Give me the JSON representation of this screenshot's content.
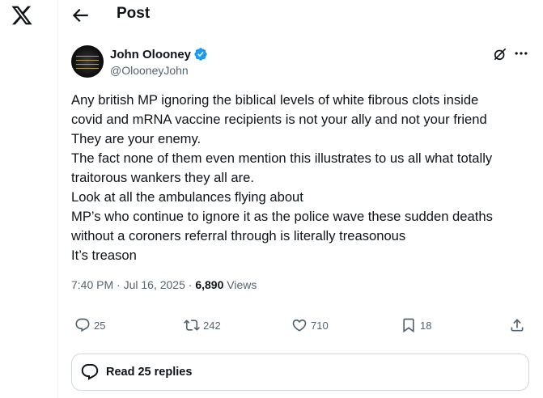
{
  "header": {
    "title": "Post"
  },
  "author": {
    "display_name": "John Olooney",
    "handle": "@OlooneyJohn",
    "verified_color": "#1d9bf0"
  },
  "tweet": {
    "lines": [
      "Any british MP ignoring the biblical levels of white fibrous clots inside",
      "covid and mRNA vaccine recipients is not your ally and not your friend",
      "They are your enemy.",
      "The fact none of them even mention this illustrates to us all what totally",
      "traitorous wankers they all are.",
      "Look at all the ambulances flying about",
      "MP’s who continue to ignore it as the police wave these sudden deaths",
      "without a coroners referral through is literally treasonous",
      "It’s treason"
    ]
  },
  "meta": {
    "time": "7:40 PM",
    "separator": "·",
    "date": "Jul 16, 2025",
    "views_count": "6,890",
    "views_label": "Views"
  },
  "actions": {
    "replies": "25",
    "reposts": "242",
    "likes": "710",
    "bookmarks": "18"
  },
  "icons": [
    "x-logo-icon",
    "back-arrow-icon",
    "verified-badge-icon",
    "grok-icon",
    "more-icon",
    "reply-icon",
    "repost-icon",
    "like-icon",
    "bookmark-icon",
    "share-icon",
    "replies-bubble-icon"
  ],
  "replies_box": {
    "label": "Read 25 replies"
  }
}
